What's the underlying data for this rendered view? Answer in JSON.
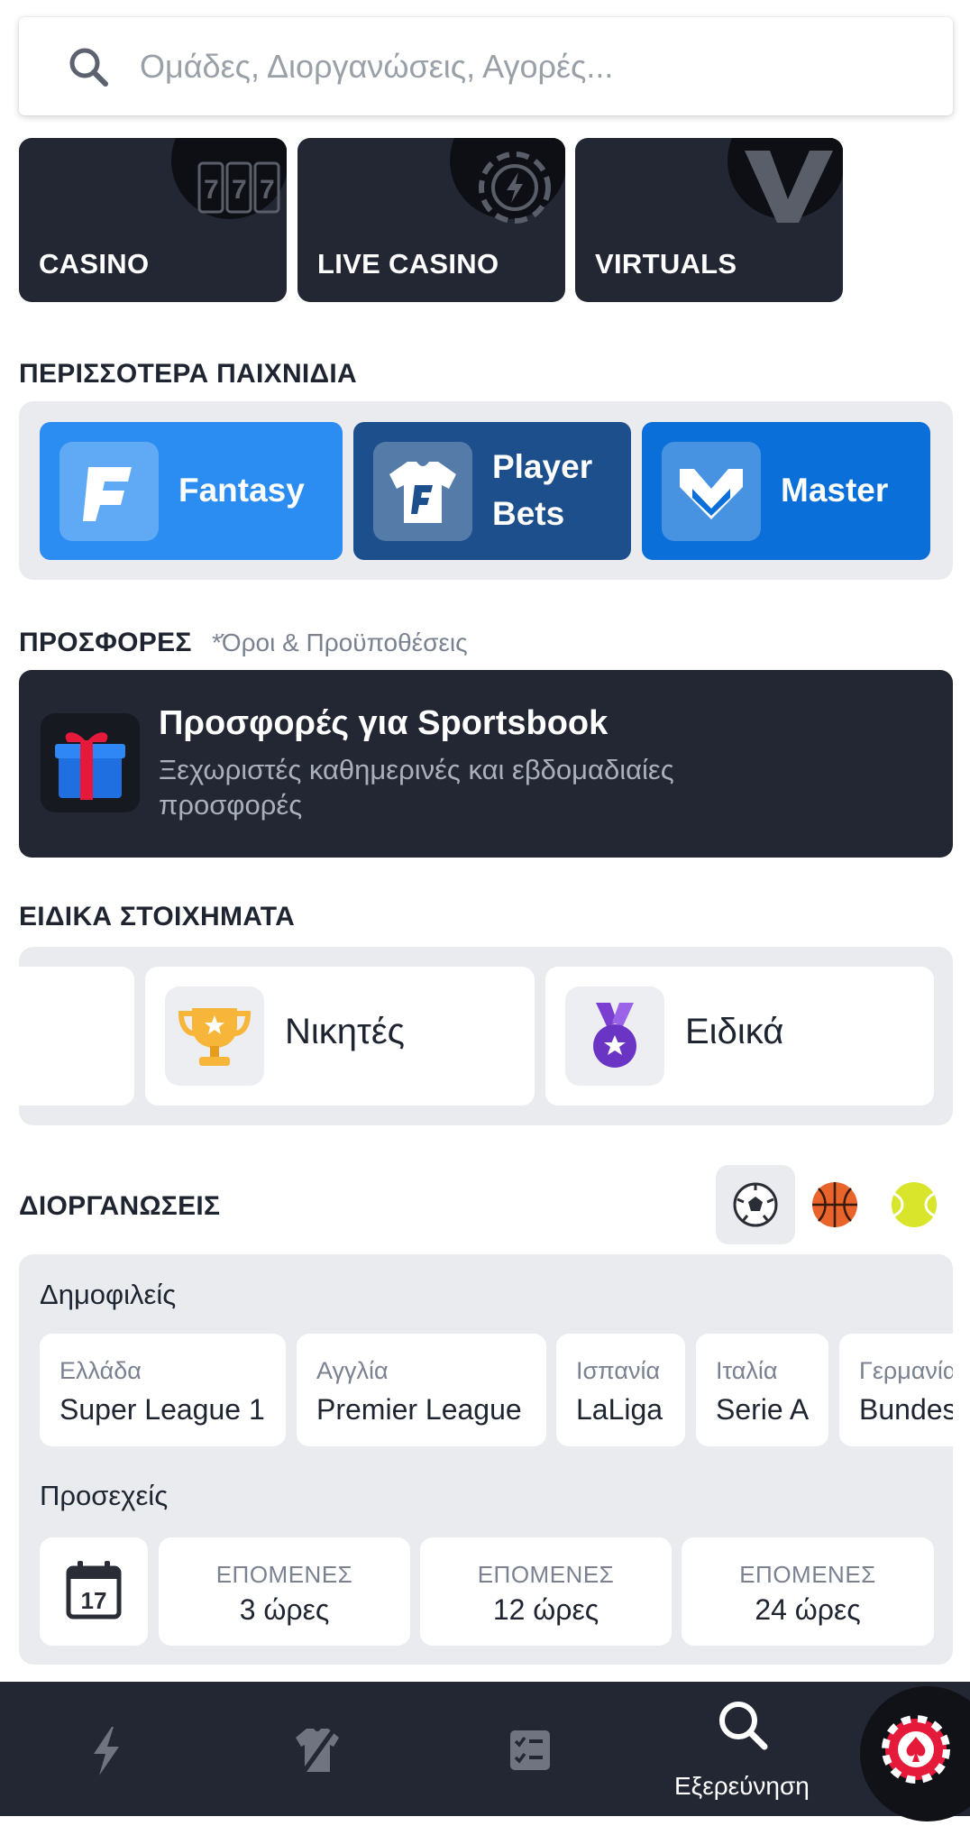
{
  "search": {
    "placeholder": "Ομάδες, Διοργανώσεις, Αγορές..."
  },
  "games": [
    {
      "label": "CASINO",
      "icon": "slot-777-icon"
    },
    {
      "label": "LIVE CASINO",
      "icon": "lightning-chip-icon"
    },
    {
      "label": "VIRTUALS",
      "icon": "virtuals-v-icon"
    }
  ],
  "more_games": {
    "title": "ΠΕΡΙΣΣΟΤΕΡΑ ΠΑΙΧΝΙΔΙΑ",
    "items": [
      {
        "line1": "Fantasy",
        "line2": "",
        "color": "#2b8cf2",
        "icon": "fantasy-f-icon"
      },
      {
        "line1": "Player",
        "line2": "Bets",
        "color": "#1d4f8c",
        "icon": "jersey-icon"
      },
      {
        "line1": "Master",
        "line2": "",
        "color": "#0a6fd8",
        "icon": "master-m-icon"
      }
    ]
  },
  "promotions": {
    "title": "ΠΡΟΣΦΟΡΕΣ",
    "terms_link": "*Όροι & Προϋποθέσεις",
    "card": {
      "title": "Προσφορές για Sportsbook",
      "subtitle": "Ξεχωριστές καθημερινές και εβδομαδιαίες προσφορές",
      "icon": "gift-icon"
    }
  },
  "specials": {
    "title": "ΕΙΔΙΚΑ ΣΤΟΙΧΗΜΑΤΑ",
    "items": [
      {
        "label": "Νικητές",
        "icon": "trophy-icon"
      },
      {
        "label": "Ειδικά",
        "icon": "medal-icon"
      }
    ]
  },
  "competitions": {
    "title": "ΔΙΟΡΓΑΝΩΣΕΙΣ",
    "sports": [
      "soccer-ball-icon",
      "basketball-icon",
      "tennis-ball-icon"
    ],
    "popular_title": "Δημοφιλείς",
    "popular": [
      {
        "country": "Ελλάδα",
        "league": "Super League 1"
      },
      {
        "country": "Αγγλία",
        "league": "Premier League"
      },
      {
        "country": "Ισπανία",
        "league": "LaLiga"
      },
      {
        "country": "Ιταλία",
        "league": "Serie A"
      },
      {
        "country": "Γερμανία",
        "league": "Bundesliga"
      }
    ],
    "upcoming_title": "Προσεχείς",
    "calendar_day": "17",
    "upcoming": [
      {
        "label": "ΕΠΟΜΕΝΕΣ",
        "value": "3 ώρες"
      },
      {
        "label": "ΕΠΟΜΕΝΕΣ",
        "value": "12 ώρες"
      },
      {
        "label": "ΕΠΟΜΕΝΕΣ",
        "value": "24 ώρες"
      }
    ]
  },
  "bottom_nav": {
    "items": [
      "lightning-icon",
      "jersey-icon",
      "betslip-icon",
      "search-icon"
    ],
    "active_label": "Εξερεύνηση",
    "fab_icon": "casino-chip-icon"
  },
  "colors": {
    "dark_tile": "#232733",
    "section_bg": "#e9ebef",
    "accent_red": "#e5193a"
  }
}
